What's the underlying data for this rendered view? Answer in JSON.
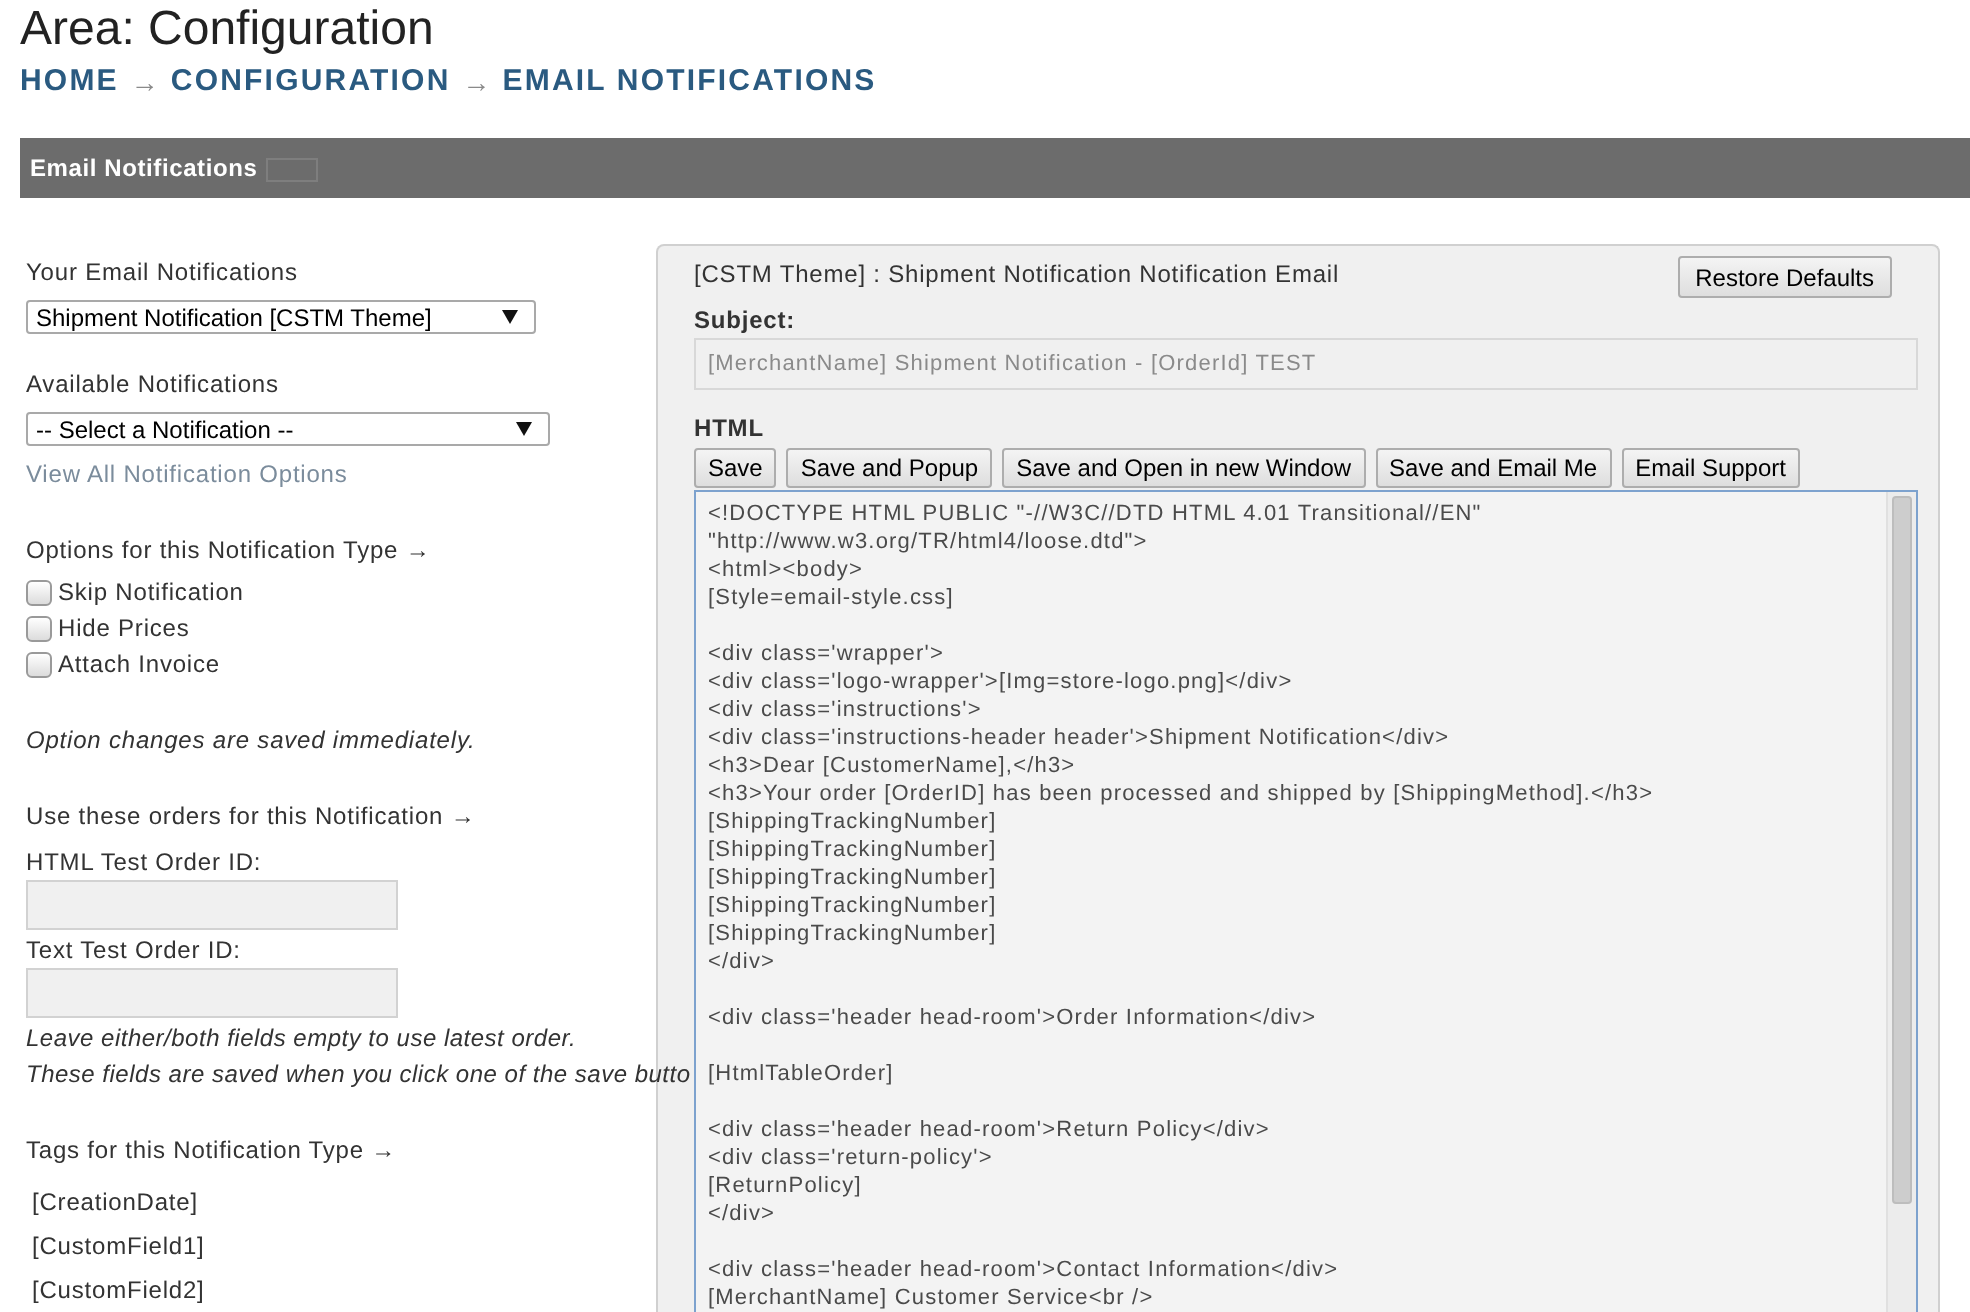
{
  "page": {
    "title": "Area: Configuration"
  },
  "breadcrumb": [
    {
      "label": "HOME"
    },
    {
      "label": "CONFIGURATION"
    },
    {
      "label": "EMAIL NOTIFICATIONS"
    }
  ],
  "breadcrumb_separators": [
    "→",
    "→"
  ],
  "section_bar": {
    "title": "Email Notifications"
  },
  "sidebar": {
    "your_notifications": {
      "label": "Your Email Notifications",
      "value": "Shipment Notification [CSTM Theme]"
    },
    "available_notifications": {
      "label": "Available Notifications",
      "value": "-- Select a Notification --"
    },
    "view_all_link": "View All Notification Options",
    "options_heading": "Options for this Notification Type →",
    "options": [
      {
        "label": "Skip Notification",
        "checked": false
      },
      {
        "label": "Hide Prices",
        "checked": false
      },
      {
        "label": "Attach Invoice",
        "checked": false
      }
    ],
    "options_note": "Option changes are saved immediately.",
    "orders_heading": "Use these orders for this Notification →",
    "order_fields": [
      {
        "label": "HTML Test Order ID:"
      },
      {
        "label": "Text Test Order ID:"
      }
    ],
    "order_notes": [
      "Leave either/both fields empty to use latest order.",
      "These fields are saved when you click one of the save butto"
    ],
    "tags_heading": "Tags for this Notification Type →",
    "tags": [
      "[CreationDate]",
      "[CustomField1]",
      "[CustomField2]"
    ]
  },
  "editor": {
    "title": "[CSTM Theme] : Shipment Notification Notification Email",
    "restore_button": "Restore Defaults",
    "subject_label": "Subject:",
    "subject_value": "[MerchantName] Shipment Notification - [OrderId] TEST",
    "html_label": "HTML",
    "buttons": [
      "Save",
      "Save and Popup",
      "Save and Open in new Window",
      "Save and Email Me",
      "Email Support"
    ],
    "html_value": "<!DOCTYPE HTML PUBLIC \"-//W3C//DTD HTML 4.01 Transitional//EN\"\n\"http://www.w3.org/TR/html4/loose.dtd\">\n<html><body>\n[Style=email-style.css]\n\n<div class='wrapper'>\n<div class='logo-wrapper'>[Img=store-logo.png]</div>\n<div class='instructions'>\n<div class='instructions-header header'>Shipment Notification</div>\n<h3>Dear [CustomerName],</h3>\n<h3>Your order [OrderID] has been processed and shipped by [ShippingMethod].</h3>\n[ShippingTrackingNumber]\n[ShippingTrackingNumber]\n[ShippingTrackingNumber]\n[ShippingTrackingNumber]\n[ShippingTrackingNumber]\n</div>\n\n<div class='header head-room'>Order Information</div>\n\n[HtmlTableOrder]\n\n<div class='header head-room'>Return Policy</div>\n<div class='return-policy'>\n[ReturnPolicy]\n</div>\n\n<div class='header head-room'>Contact Information</div>\n[MerchantName] Customer Service<br />"
  }
}
